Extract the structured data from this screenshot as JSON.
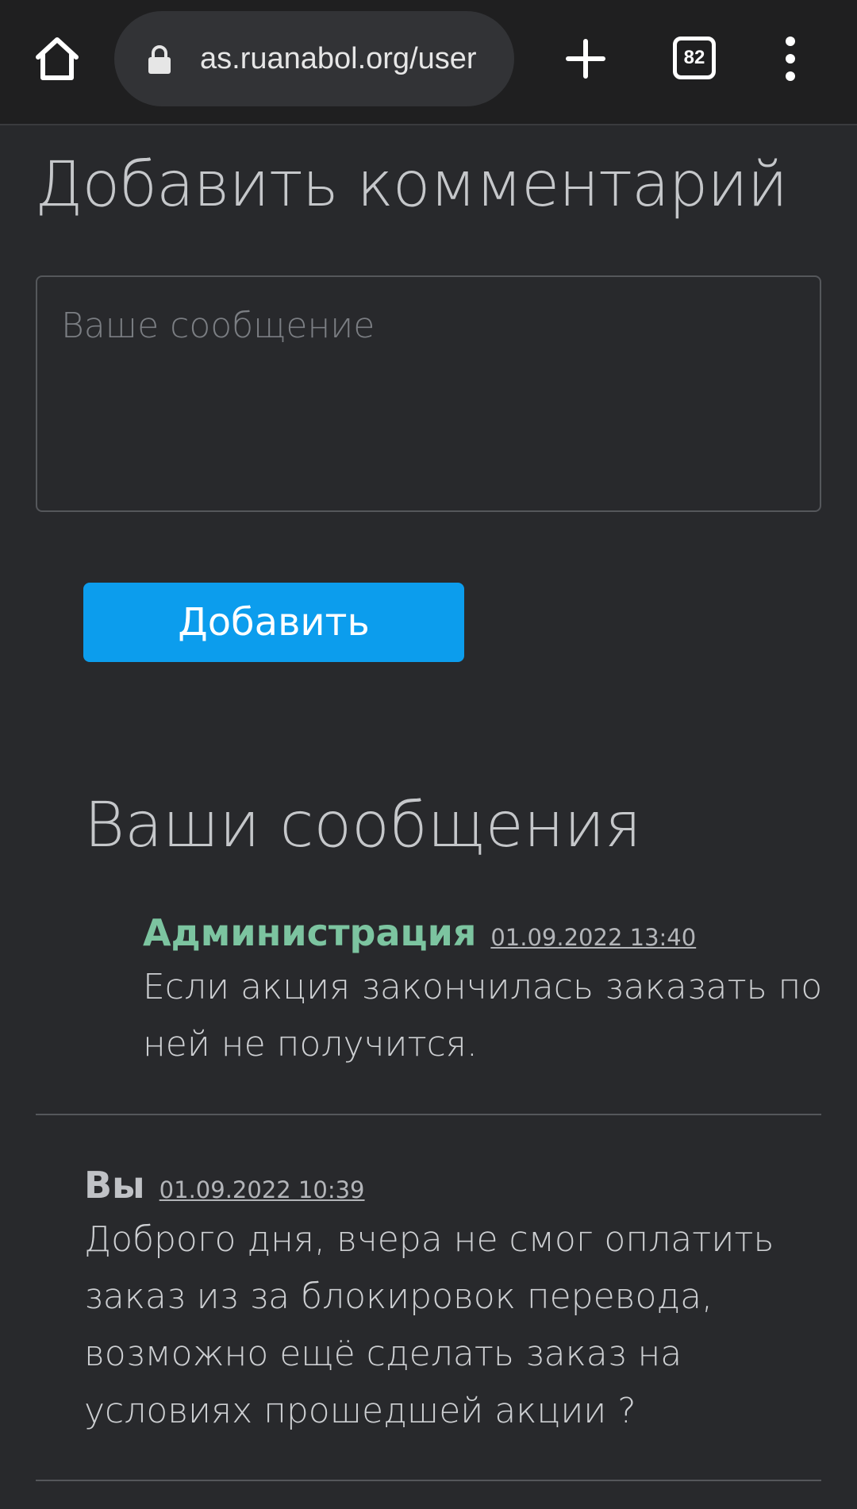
{
  "browser": {
    "url": "as.ruanabol.org/user",
    "tab_count": "82",
    "icons": {
      "home": "home-icon",
      "lock": "lock-icon",
      "new_tab": "plus-icon",
      "menu": "more-vert-icon"
    }
  },
  "comment_form": {
    "title": "Добавить комментарий",
    "placeholder": "Ваше сообщение",
    "submit_label": "Добавить"
  },
  "messages": {
    "title": "Ваши сообщения",
    "items": [
      {
        "author": "Администрация",
        "date": "01.09.2022 13:40",
        "text": "Если акция закончилась заказать по ней не получится."
      },
      {
        "author": "Вы",
        "date": "01.09.2022 10:39",
        "text": "Доброго дня, вчера не смог оплатить заказ из за блокировок перевода, возможно ещё сделать заказ на условиях прошедшей акции ?"
      }
    ]
  },
  "colors": {
    "background": "#28292c",
    "topbar": "#1f1f20",
    "button": "#0c9ded",
    "admin_name": "#7cc4a0"
  }
}
